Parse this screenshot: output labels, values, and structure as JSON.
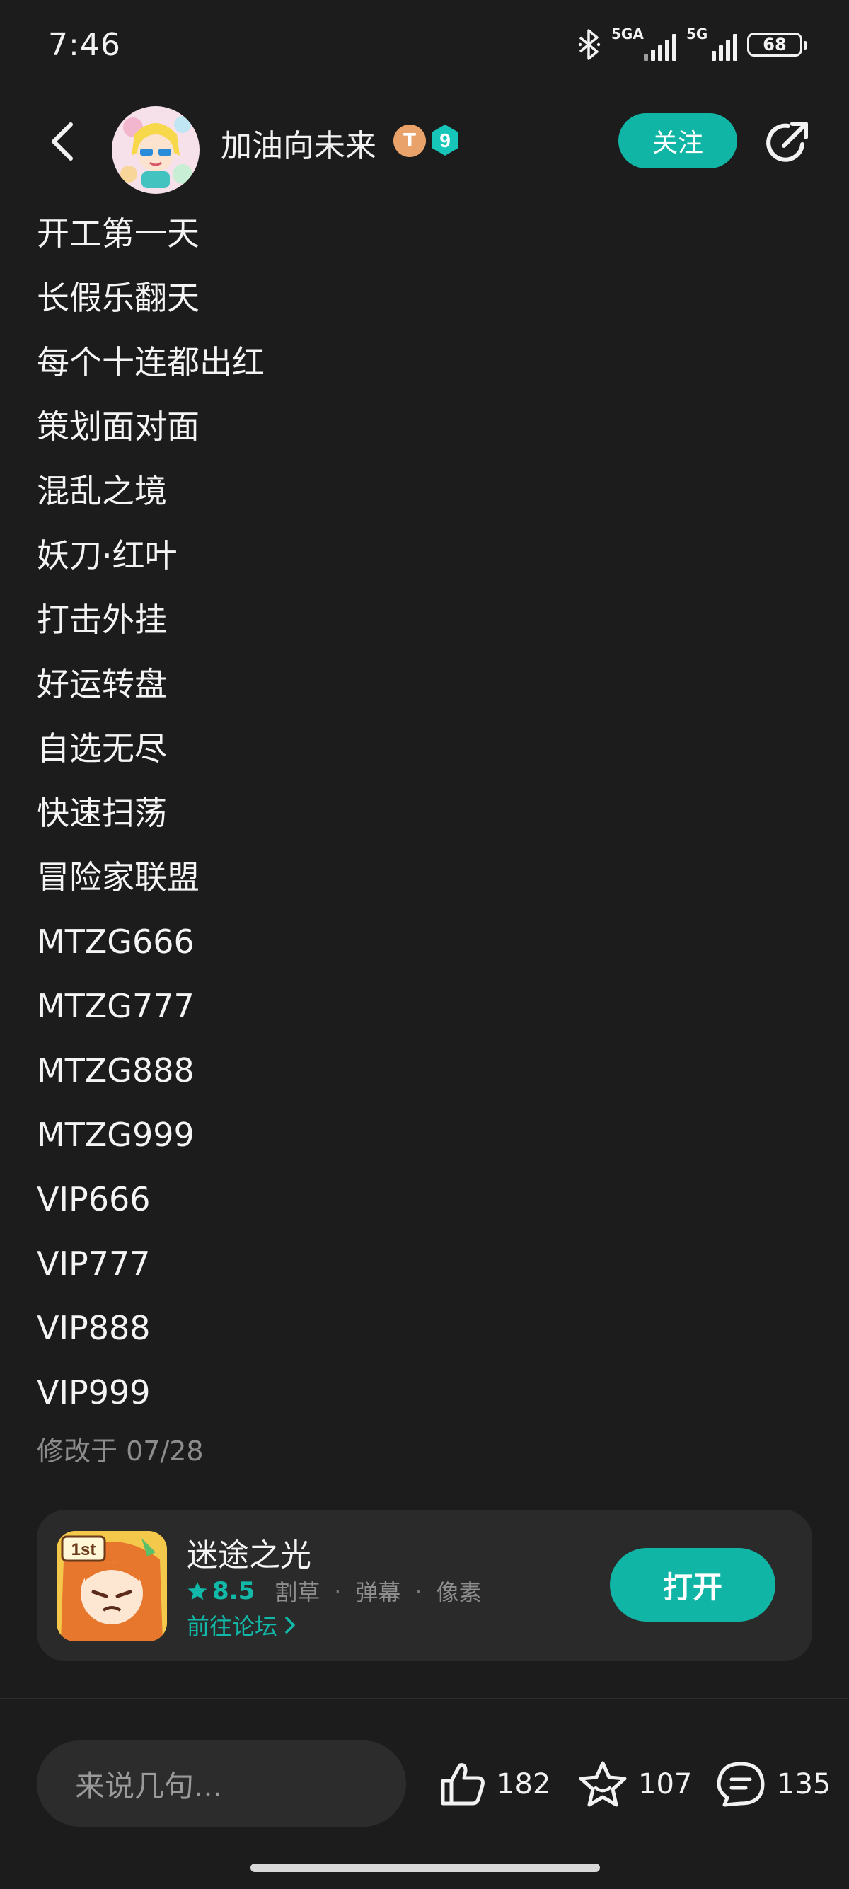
{
  "status_bar": {
    "time": "7:46",
    "network_1": "5GA",
    "network_2": "5G",
    "battery": "68"
  },
  "header": {
    "username": "加油向未来",
    "badge_letter": "T",
    "level": "9",
    "follow_label": "关注"
  },
  "codes": [
    "开工第一天",
    "长假乐翻天",
    "每个十连都出红",
    "策划面对面",
    "混乱之境",
    "妖刀·红叶",
    "打击外挂",
    "好运转盘",
    "自选无尽",
    "快速扫荡",
    "冒险家联盟",
    "MTZG666",
    "MTZG777",
    "MTZG888",
    "MTZG999",
    "VIP666",
    "VIP777",
    "VIP888",
    "VIP999"
  ],
  "modified": "修改于 07/28",
  "game": {
    "name": "迷途之光",
    "score": "8.5",
    "tags": [
      "割草",
      "弹幕",
      "像素"
    ],
    "forum_link": "前往论坛",
    "open_label": "打开",
    "icon_badge": "1st"
  },
  "bottom": {
    "comment_placeholder": "来说几句...",
    "likes": "182",
    "favorites": "107",
    "comments": "135"
  },
  "colors": {
    "accent": "#10b5a6",
    "background": "#1c1c1c",
    "card": "#2a2a2a"
  }
}
